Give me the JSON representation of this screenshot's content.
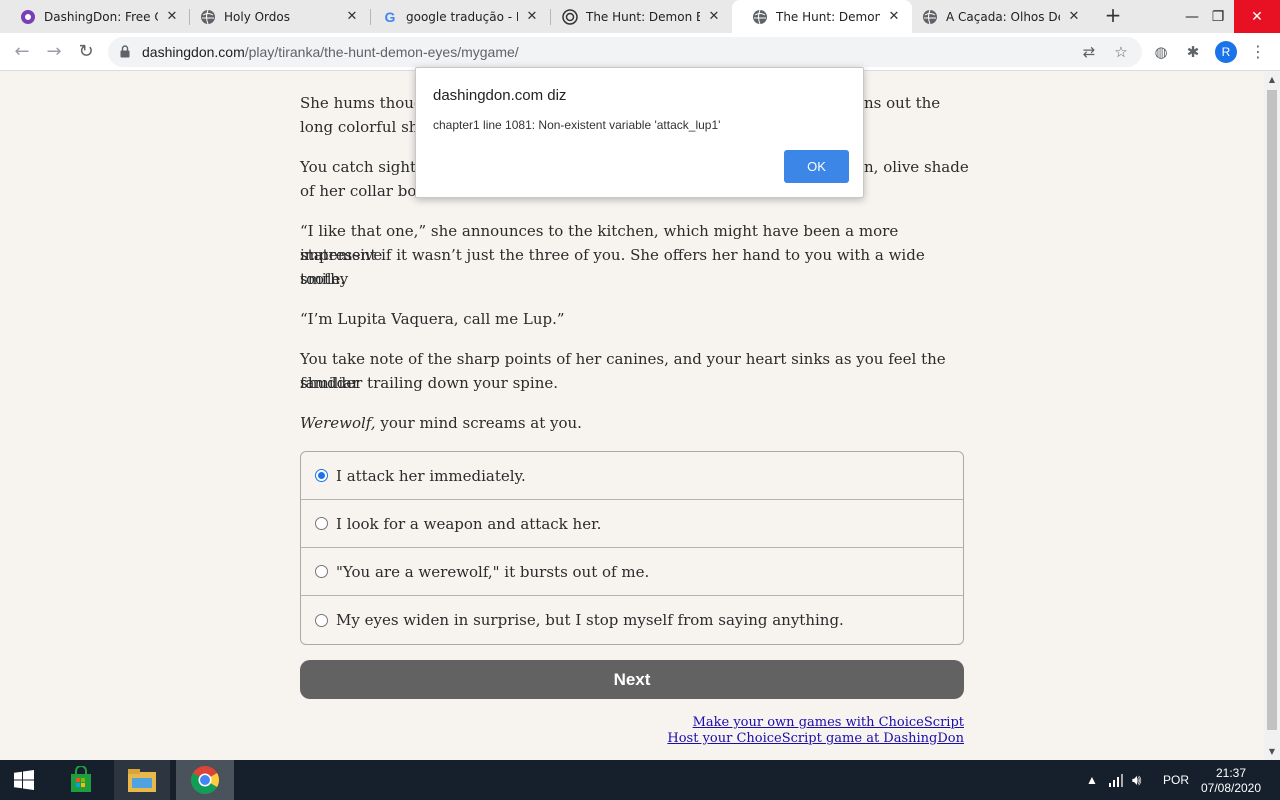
{
  "browser": {
    "tabs": [
      {
        "title": "DashingDon: Free Cho",
        "icon": "dashingdon-icon"
      },
      {
        "title": "Holy Ordos",
        "icon": "globe-icon"
      },
      {
        "title": "google tradução - Pes",
        "icon": "google-icon"
      },
      {
        "title": "The Hunt: Demon Eye",
        "icon": "choicescript-icon"
      },
      {
        "title": "The Hunt: Demon Eye",
        "icon": "globe-icon"
      },
      {
        "title": "A Caçada: Olhos Dem",
        "icon": "globe-icon"
      }
    ],
    "active_tab": 4,
    "url_domain": "dashingdon.com",
    "url_path": "/play/tiranka/the-hunt-demon-eyes/mygame/",
    "avatar_letter": "R"
  },
  "story": {
    "paragraphs": [
      "She hums thoug",
      "long colorful shir",
      "You catch sight o",
      "of her collar bone",
      "“I like that one,” she announces to the kitchen, which might have been a more impressive",
      "statement if it wasn’t just the three of you. She offers her hand to you with a wide toothy",
      "smile.",
      "“I’m Lupita Vaquera, call me Lup.”",
      "You take note of the sharp points of her canines, and your heart sinks as you feel the familiar",
      "shudder trailing down your spine.",
      "Werewolf,",
      " your mind screams at you."
    ],
    "hidden_fragments": [
      "ns out the",
      "n, olive shade"
    ],
    "choices": [
      "I attack her immediately.",
      "I look for a weapon and attack her.",
      "\"You are a werewolf,\" it bursts out of me.",
      "My eyes widen in surprise, but I stop myself from saying anything."
    ],
    "selected_choice": 0,
    "next_label": "Next",
    "footer_links": [
      "Make your own games with ChoiceScript",
      "Host your ChoiceScript game at DashingDon"
    ]
  },
  "dialog": {
    "title": "dashingdon.com diz",
    "message": "chapter1 line 1081: Non-existent variable 'attack_lup1'",
    "ok_label": "OK"
  },
  "taskbar": {
    "language": "POR",
    "time": "21:37",
    "date": "07/08/2020"
  }
}
